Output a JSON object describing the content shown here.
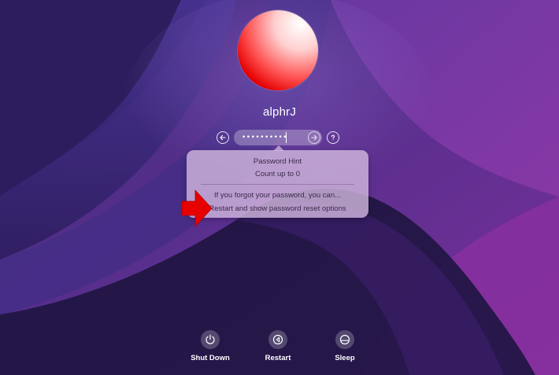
{
  "user": {
    "name": "alphrJ"
  },
  "password_field": {
    "masked_value": "••••••••••"
  },
  "hint_popover": {
    "title": "Password Hint",
    "hint": "Count up to 0",
    "forgot_text": "If you forgot your password, you can...",
    "reset_link": "Restart and show password reset options"
  },
  "power_buttons": [
    {
      "label": "Shut Down",
      "icon": "power-icon"
    },
    {
      "label": "Restart",
      "icon": "restart-icon"
    },
    {
      "label": "Sleep",
      "icon": "sleep-icon"
    }
  ],
  "colors": {
    "annotation_arrow": "#e60000",
    "avatar": "#e60000"
  },
  "icons": {
    "back": "back-arrow-icon",
    "submit": "submit-arrow-icon",
    "help": "help-icon"
  }
}
